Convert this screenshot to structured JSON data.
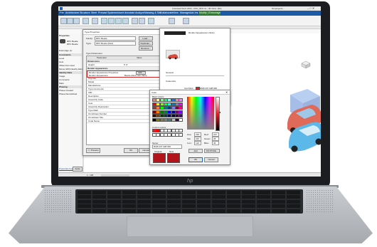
{
  "window": {
    "title": "Autodesk Revit 2024 - RAC_BCF.rvt - 3D View: {3D}",
    "user": "bimprojects..."
  },
  "menu": {
    "items": [
      "File",
      "Architecture",
      "Structure",
      "Steel",
      "Precast",
      "Systems",
      "Insert",
      "Annotate",
      "Analyze",
      "Massing & Site",
      "Collaborate",
      "View",
      "Manage",
      "Add-Ins",
      "Modify | Entourage"
    ]
  },
  "properties": {
    "header": "Properties",
    "type_name": "RPC Beetle",
    "type_sub": "RPC Beetle",
    "category": "Entourage (1)",
    "sections": [
      "Constraints",
      "Level",
      "Host",
      "Offset from Host",
      "Moves With Nearby Elem",
      "Identity Data",
      "Image",
      "Comments",
      "Mark",
      "Phasing",
      "Phase Created",
      "Phase Demolished"
    ],
    "help_link": "Properties help",
    "apply": "Apply"
  },
  "type_dialog": {
    "title": "Type Properties",
    "family_label": "Family:",
    "family_value": "RPC Beetle",
    "type_label": "Type:",
    "type_value": "RPC Beetle (Red)",
    "load": "Load...",
    "duplicate": "Duplicate...",
    "rename": "Rename...",
    "params_label": "Type Parameters",
    "col_param": "Parameter",
    "col_value": "Value",
    "group_dimensions": "Dimensions",
    "height_label": "Height",
    "height_value": "5' 0\"",
    "group_render": "Render Appearance",
    "render_props_label": "Render Appearance Properties",
    "render_props_value": "Edit...",
    "render_app_label": "Render Appearance",
    "render_app_value": "Beetle (Red Color Skin)",
    "identity_rows": [
      "Keynote",
      "Model",
      "Manufacturer",
      "Type Comments",
      "URL",
      "Description",
      "Assembly Code",
      "Cost",
      "Assembly Description",
      "Type Mark",
      "OmniClass Number",
      "OmniClass Title",
      "Code Name"
    ],
    "preview": "<< Preview",
    "ok": "OK",
    "cancel": "Cancel",
    "apply": "Apply"
  },
  "render_dialog": {
    "title": "Render Appearance Library",
    "general": "General",
    "color_label": "Car Paint",
    "color_value": "RGB 237 028 036",
    "customize": "Customize"
  },
  "color_dialog": {
    "title": "Color",
    "basic_label": "Basic colors:",
    "custom_label": "Custom colors:",
    "name_label": "Name:",
    "rgb": "RGB 237 028 036",
    "original": "Original",
    "new": "New",
    "hue": "239",
    "sat": "240",
    "lum": "120",
    "red": "237",
    "green": "28",
    "blue": "36",
    "add": "Add",
    "pick": "PANTONE...",
    "ok": "OK",
    "cancel": "Cancel"
  },
  "view": {
    "scale": "1 : 100"
  },
  "colors": {
    "menubar": "#1b5aa5",
    "selection": "#3399ff",
    "car_red": "#e06a5a",
    "car_blue": "#5bb8e8"
  }
}
